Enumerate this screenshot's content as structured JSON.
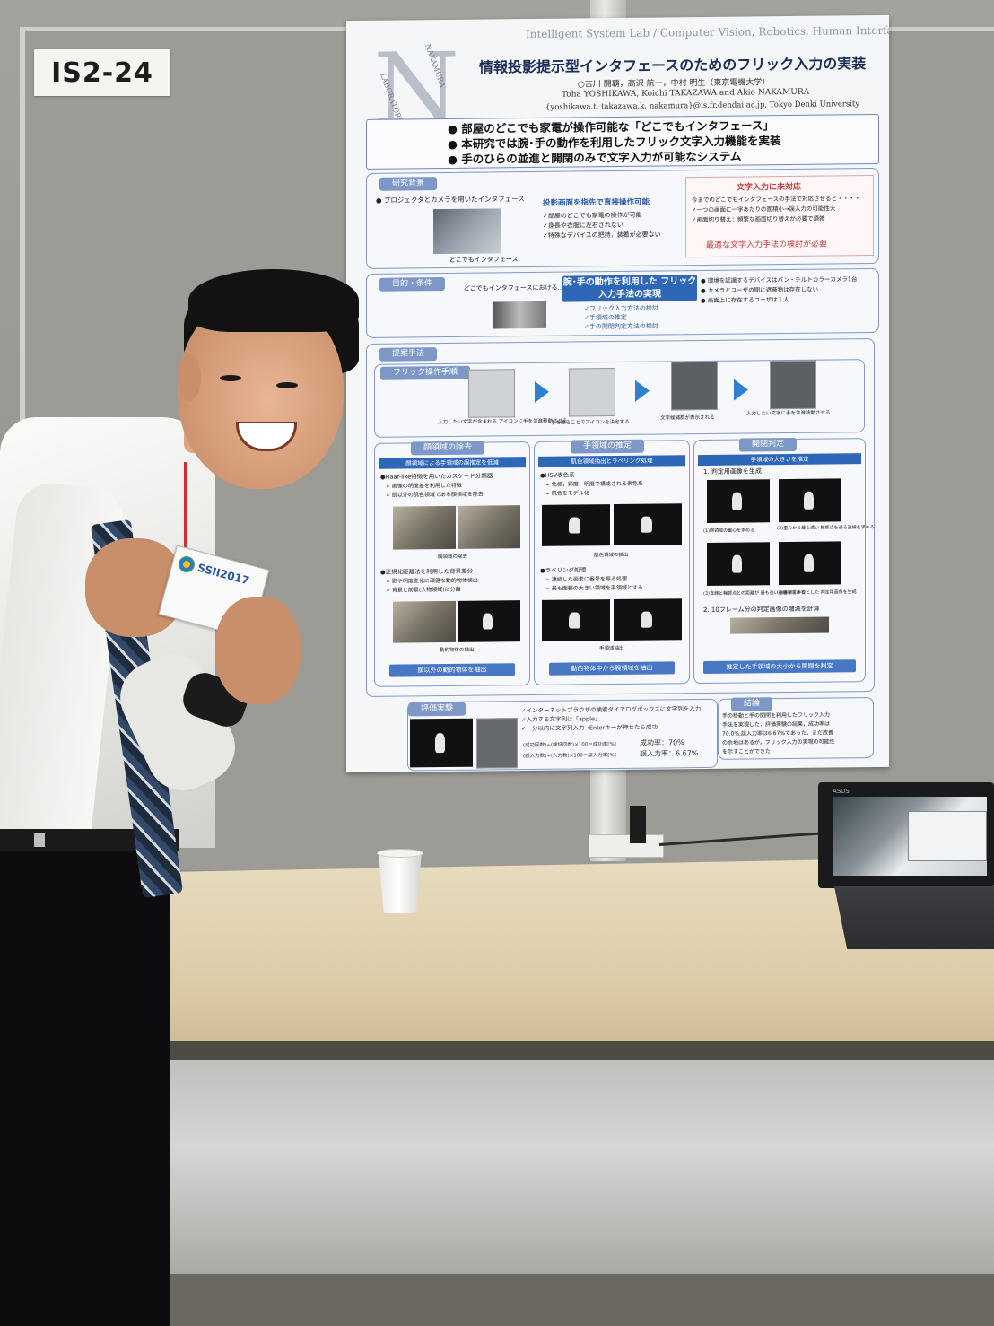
{
  "booth": {
    "id": "IS2-24"
  },
  "poster": {
    "lab": "Intelligent System Lab / Computer Vision, Robotics, Human Interface",
    "title": "情報投影提示型インタフェースのためのフリック入力の実装",
    "authors_ja": "○吉川 闘覇，高沢 航一，中村 明生（東京電機大学）",
    "authors_en": "Toha YOSHIKAWA, Koichi TAKAZAWA and Akio NAKAMURA",
    "email": "{yoshikawa.t, takazawa.k, nakamura}@is.fr.dendai.ac.jp, Tokyo Denki University",
    "logo_text": "NAKAMURA LABORATORY",
    "summary": [
      "● 部屋のどこでも家電が操作可能な「どこでもインタフェース」",
      "● 本研究では腕･手の動作を利用したフリック文字入力機能を実装",
      "● 手のひらの並進と開閉のみで文字入力が可能なシステム"
    ],
    "background": {
      "tab": "研究背景",
      "item": "● プロジェクタとカメラを用いたインタフェース",
      "caption": "どこでもインタフェース",
      "head": "投影画面を指先で直接操作可能",
      "points": [
        "✓部屋のどこでも家電の操作が可能",
        "✓身長や衣服に左右されない",
        "✓特殊なデバイスの把持，装着が必要ない"
      ],
      "issue_title": "文字入力に未対応",
      "issue_lines": [
        "今までのどこでもインタフェースの手法で対応させると・・・・",
        "✓一つの画面に一字あたりの面積小→誤入力の可能性大",
        "✓画面切り替え：頻繁な画面切り替えが必要で煩雑"
      ],
      "issue_bottom": "最適な文字入力手法の検討が必要"
    },
    "purpose": {
      "tab": "目的・条件",
      "lead": "どこでもインタフェースにおける…",
      "goal": "腕･手の動作を利用した フリック入力手法の実現",
      "checks": [
        "✓フリック入力方法の検討",
        "✓手領域の推定",
        "✓手の開閉判定方法の検討"
      ],
      "conditions": [
        "● 環境を認識するデバイスはパン・チルトカラーカメラ1台",
        "● カメラとユーザの間に遮蔽物は存在しない",
        "● 画面上に存在するユーザは１人"
      ]
    },
    "method": {
      "tab": "提案手法",
      "flow_tab": "フリック操作手順",
      "steps": [
        "入力したい文字が含まれる アイコンに手を並進移動させる",
        "手を握ることでアイコンを決定する",
        "文字候補群が表示される",
        "入力したい文字に手を並進移動させる"
      ],
      "col1_tab": "顔領域の除去",
      "col1_head": "顔領域による手領域の誤推定を低減",
      "col1_a": "●Haar-like特徴を用いたカスケード分類器",
      "col1_a_sub": [
        "➢ 画像の明度差を利用した特徴",
        "➢ 肌以外の肌色領域である顔領域を除去"
      ],
      "col1_a_cap": "顔領域の除去",
      "col1_b": "●正規化距離法を利用した背景差分",
      "col1_b_sub": [
        "➢ 影や明度変化に頑健な動的物体検出",
        "➢ 背景と前景(人物領域)に分離"
      ],
      "col1_b_cap": "動的物体の抽出",
      "col1_foot": "顔以外の動的物体を抽出",
      "col2_tab": "手領域の推定",
      "col2_head": "肌色領域抽出とラベリング処理",
      "col2_a": "●HSV表色系",
      "col2_a_sub": [
        "➢ 色相，彩度，明度で構成される表色系",
        "➢ 肌色をモデル化"
      ],
      "col2_a_cap": "肌色領域の抽出",
      "col2_b": "●ラベリング処理",
      "col2_b_sub": [
        "➢ 連続した画素に番号を振る処理",
        "➢ 最も面積の大きい領域を手領域とする"
      ],
      "col2_b_cap": "手領域抽出",
      "col2_foot": "動的物体中から腕領域を抽出",
      "col3_tab": "開閉判定",
      "col3_head": "手領域の大きさを推定",
      "col3_step1": "1. 判定用画像を生成",
      "col3_caps": [
        "(1)腕領域の重心を求める",
        "(2)重心から最も遠い 輪郭点を通る直線を求める",
        "(3)直線と輪郭点との距離が 最も長い垂線を求める",
        "(4)垂線を半径とした 判定用画像を生成"
      ],
      "col3_step2": "2. 10フレーム分の判定画像の増減を計算",
      "col3_foot": "推定した手領域の大小から開閉を判定"
    },
    "eval": {
      "tab": "評価実験",
      "points": [
        "✓インターネットブラウザの検索ダイアログボックスに文字列を入力",
        "✓入力する文字列は「apple」",
        "✓一分以内に文字列入力→Enterキーが押せたら成功"
      ],
      "formula1": "(成功回数)÷(検証回数)×100＝成功率[%]",
      "formula2": "(誤入力数)÷(入力数)×100＝誤入力率[%]",
      "success": "成功率：70%",
      "error": "誤入力率：6.67%"
    },
    "conclusion": {
      "tab": "結論",
      "text": [
        "手の移動と手の開閉を利用したフリック入力",
        "手法を実現した．評価実験の結果，成功率は",
        "70.0%,誤入力率は6.67%であった．まだ改善",
        "の余地はあるが，フリック入力の実現の可能性",
        "を示すことができた．"
      ]
    }
  },
  "badge": {
    "event": "SSII2017"
  },
  "laptop": {
    "brand": "ASUS"
  },
  "colors": {
    "poster_blue": "#2f67b8",
    "section_border": "#7f9ac9",
    "warning_red": "#c03b3b",
    "lanyard_red": "#d62b2b"
  }
}
